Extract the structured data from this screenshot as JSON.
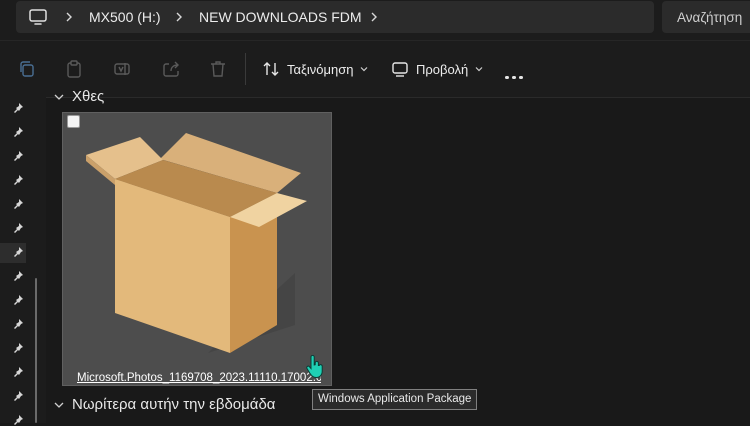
{
  "address": {
    "crumbs": [
      "MX500 (H:)",
      "NEW DOWNLOADS FDM"
    ],
    "search_placeholder": "Αναζήτηση"
  },
  "toolbar": {
    "sort_label": "Ταξινόμηση",
    "view_label": "Προβολή"
  },
  "content": {
    "group_yesterday": "Χθες",
    "group_earlier": "Νωρίτερα αυτήν την εβδομάδα",
    "file": {
      "name": "Microsoft.Photos_1169708_2023.11110.17002.0",
      "tooltip": "Windows Application Package"
    }
  },
  "sidebar": {
    "pin_count": 14
  }
}
